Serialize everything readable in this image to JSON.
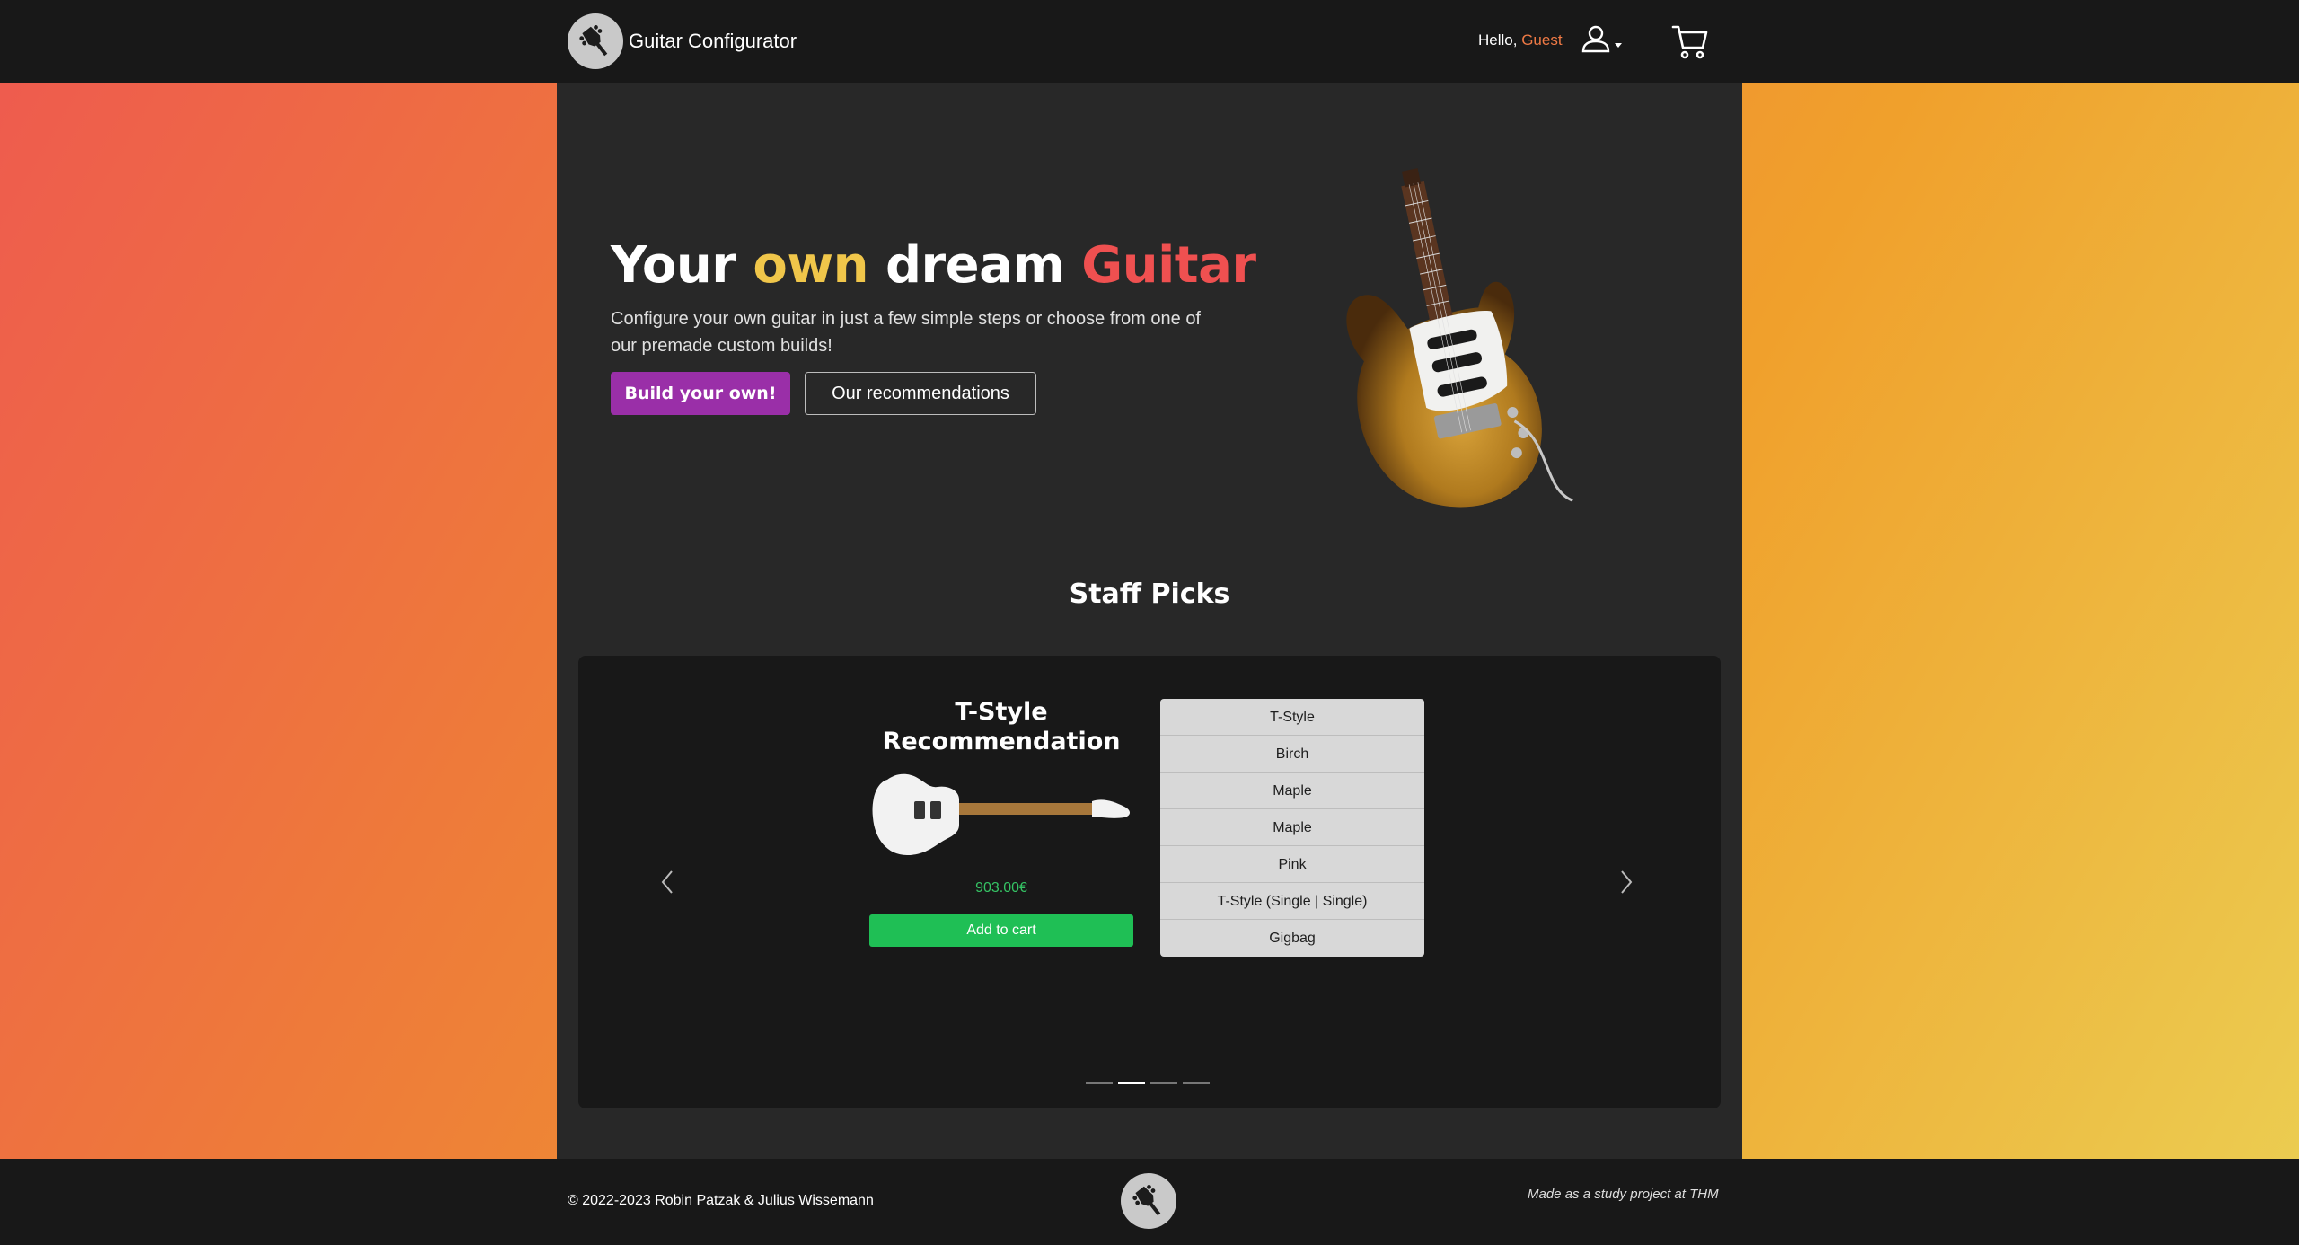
{
  "navbar": {
    "brand": "Guitar Configurator",
    "hello_prefix": "Hello,",
    "user_name": "Guest",
    "icons": {
      "logo": "guitar-headstock-logo-icon",
      "user": "user-icon",
      "cart": "cart-icon"
    }
  },
  "hero": {
    "title_parts": [
      "Your",
      "own",
      "dream",
      "Guitar"
    ],
    "subtitle": "Configure your own guitar in just a few simple steps or choose from one of our premade custom builds!",
    "build_button": "Build your own!",
    "recommendations_button": "Our recommendations"
  },
  "staff_picks": {
    "title": "Staff Picks",
    "card": {
      "title": "T-Style Recommendation",
      "price": "903.00€",
      "add_to_cart": "Add to cart",
      "specs": [
        "T-Style",
        "Birch",
        "Maple",
        "Maple",
        "Pink",
        "T-Style (Single | Single)",
        "Gigbag"
      ]
    },
    "slides_total": 4,
    "active_slide": 2
  },
  "footer": {
    "copyright": "© 2022-2023 Robin Patzak & Julius Wissemann",
    "made_by": "Made as a study project at THM"
  },
  "colors": {
    "accent_yellow": "#f0c64a",
    "accent_red": "#ef5050",
    "build_button": "#9a2fa8",
    "add_to_cart": "#1fbf55",
    "price": "#35c364",
    "guest": "#f07a45"
  }
}
